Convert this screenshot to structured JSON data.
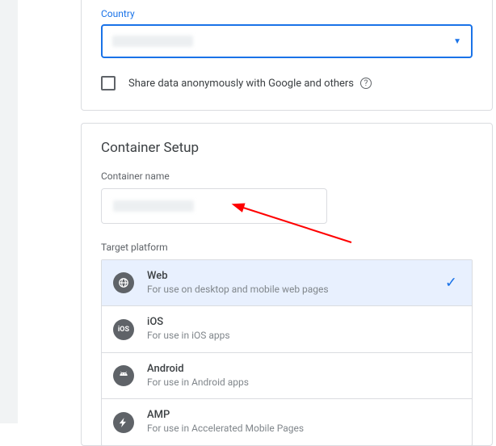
{
  "account": {
    "country_label": "Country",
    "country_value": "",
    "share_checkbox_label": "Share data anonymously with Google and others"
  },
  "container": {
    "section_title": "Container Setup",
    "name_label": "Container name",
    "name_value": "",
    "platform_label": "Target platform",
    "platforms": [
      {
        "key": "web",
        "title": "Web",
        "desc": "For use on desktop and mobile web pages",
        "selected": true
      },
      {
        "key": "ios",
        "title": "iOS",
        "desc": "For use in iOS apps",
        "selected": false
      },
      {
        "key": "android",
        "title": "Android",
        "desc": "For use in Android apps",
        "selected": false
      },
      {
        "key": "amp",
        "title": "AMP",
        "desc": "For use in Accelerated Mobile Pages",
        "selected": false
      }
    ]
  },
  "icons": {
    "ios_text": "iOS"
  }
}
